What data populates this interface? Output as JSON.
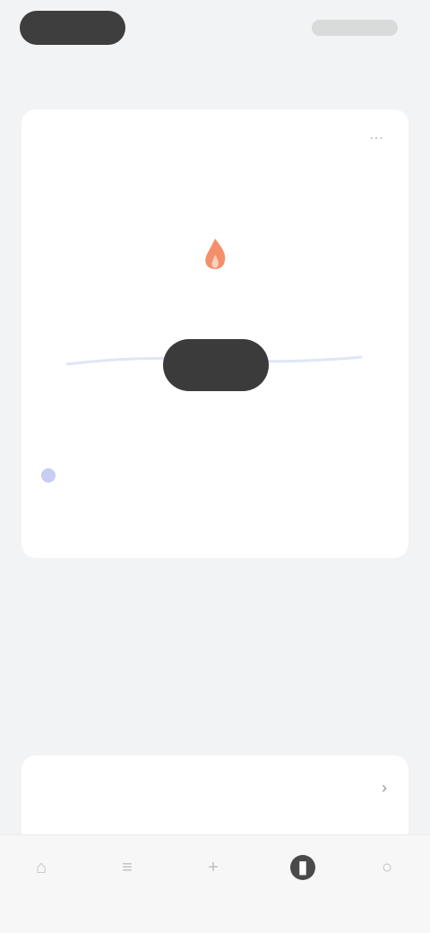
{
  "status_bar": {
    "time": ""
  },
  "header": {
    "title": ""
  },
  "main_card": {
    "title": "",
    "subtitle": "",
    "y_ticks": [
      "",
      "",
      "",
      ""
    ],
    "x_ticks": [
      "",
      "",
      "",
      "",
      "",
      "",
      ""
    ],
    "empty_text": "",
    "cta_label": "",
    "legend_a": "",
    "legend_b": "",
    "link": ""
  },
  "tip": {
    "title": "",
    "body": "",
    "link": ""
  },
  "second_card": {
    "title": "",
    "subtitle": ""
  },
  "tabbar": {
    "tabs": [
      {
        "label": "",
        "icon": "home-icon"
      },
      {
        "label": "",
        "icon": "list-icon"
      },
      {
        "label": "",
        "icon": "plus-icon"
      },
      {
        "label": "",
        "icon": "chart-icon",
        "active": true
      },
      {
        "label": "",
        "icon": "profile-icon"
      }
    ]
  },
  "colors": {
    "accent": "#f06a3b",
    "button": "#3b3b3b",
    "legend": "#c8cdf3"
  }
}
